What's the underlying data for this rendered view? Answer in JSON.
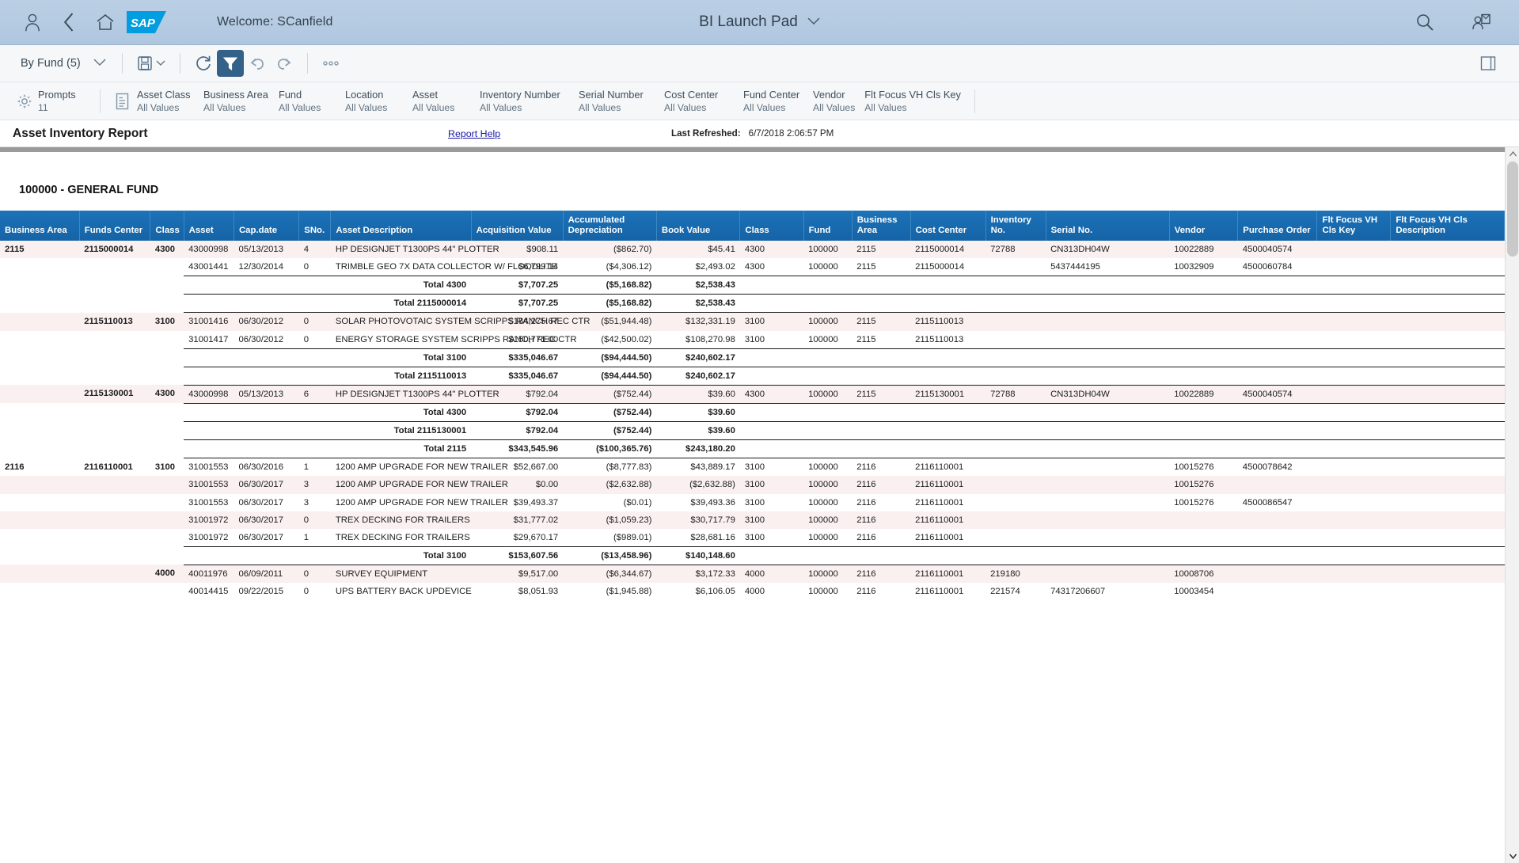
{
  "shell": {
    "welcome": "Welcome: SCanfield",
    "app_title": "BI Launch Pad",
    "icons": {
      "user": "user-icon",
      "back": "back-chevron-icon",
      "home": "home-icon",
      "logo": "sap-logo",
      "dropdown": "chevron-down-icon",
      "search": "search-icon",
      "contacts": "user-card-icon"
    },
    "colors": {
      "header_bg": "#b5cbe2",
      "sap_blue": "#009de0",
      "accent": "#346187"
    }
  },
  "toolbar": {
    "view_selector": "By Fund (5)",
    "buttons": [
      {
        "name": "save-button",
        "label": "save-icon"
      },
      {
        "name": "refresh-button",
        "label": "refresh-icon"
      },
      {
        "name": "filter-button",
        "label": "filter-icon",
        "active": true
      },
      {
        "name": "undo-button",
        "label": "undo-icon"
      },
      {
        "name": "redo-button",
        "label": "redo-icon"
      },
      {
        "name": "more-button",
        "label": "more-options-icon"
      },
      {
        "name": "sidepanel-button",
        "label": "side-panel-icon"
      }
    ]
  },
  "prompts": {
    "label": "Prompts",
    "count": "11",
    "all_values": "All Values",
    "items": [
      {
        "key": "Asset Class",
        "value": "All Values"
      },
      {
        "key": "Business Area",
        "value": "All Values"
      },
      {
        "key": "Fund",
        "value": "All Values"
      },
      {
        "key": "Location",
        "value": "All Values"
      },
      {
        "key": "Asset",
        "value": "All Values"
      },
      {
        "key": "Inventory Number",
        "value": "All Values"
      },
      {
        "key": "Serial Number",
        "value": "All Values"
      },
      {
        "key": "Cost Center",
        "value": "All Values"
      },
      {
        "key": "Fund Center",
        "value": "All Values"
      },
      {
        "key": "Vendor",
        "value": "All Values"
      },
      {
        "key": "Flt Focus VH Cls Key",
        "value": "All Values"
      }
    ]
  },
  "report": {
    "title": "Asset Inventory Report",
    "help_link": "Report Help",
    "last_refreshed_label": "Last Refreshed:",
    "last_refreshed_value": "6/7/2018 2:06:57 PM",
    "section_heading": "100000 - GENERAL FUND",
    "columns": [
      "Business Area",
      "Funds Center",
      "Class",
      "Asset",
      "Cap.date",
      "SNo.",
      "Asset Description",
      "Acquisition Value",
      "Accumulated Depreciation",
      "Book Value",
      "Class",
      "Fund",
      "Business Area",
      "Cost Center",
      "Inventory No.",
      "Serial No.",
      "Vendor",
      "Purchase Order",
      "Flt Focus VH Cls Key",
      "Flt Focus VH Cls Description"
    ],
    "rows": [
      {
        "type": "data",
        "shade": "pink",
        "business_area": "2115",
        "funds_center": "2115000014",
        "class": "4300",
        "asset": "43000998",
        "cap_date": "05/13/2013",
        "sno": "4",
        "description": "HP DESIGNJET T1300PS 44\" PLOTTER",
        "acquisition": "$908.11",
        "depreciation": "($862.70)",
        "book_value": "$45.41",
        "class2": "4300",
        "fund": "100000",
        "business_area2": "2115",
        "cost_center": "2115000014",
        "inventory_no": "72788",
        "serial_no": "CN313DH04W",
        "vendor": "10022889",
        "purchase_order": "4500040574",
        "flt_key": "",
        "flt_desc": ""
      },
      {
        "type": "data",
        "shade": "white",
        "business_area": "",
        "funds_center": "",
        "class": "",
        "asset": "43001441",
        "cap_date": "12/30/2014",
        "sno": "0",
        "description": "TRIMBLE GEO 7X DATA COLLECTOR W/ FLOODLITE",
        "acquisition": "$6,799.14",
        "depreciation": "($4,306.12)",
        "book_value": "$2,493.02",
        "class2": "4300",
        "fund": "100000",
        "business_area2": "2115",
        "cost_center": "2115000014",
        "inventory_no": "",
        "serial_no": "5437444195",
        "vendor": "10032909",
        "purchase_order": "4500060784",
        "flt_key": "",
        "flt_desc": ""
      },
      {
        "type": "total",
        "label": "Total 4300",
        "acquisition": "$7,707.25",
        "depreciation": "($5,168.82)",
        "book_value": "$2,538.43"
      },
      {
        "type": "total",
        "label": "Total 2115000014",
        "acquisition": "$7,707.25",
        "depreciation": "($5,168.82)",
        "book_value": "$2,538.43"
      },
      {
        "type": "data",
        "shade": "pink",
        "business_area": "",
        "funds_center": "2115110013",
        "class": "3100",
        "asset": "31001416",
        "cap_date": "06/30/2012",
        "sno": "0",
        "description": "SOLAR PHOTOVOTAIC SYSTEM SCRIPPS RANCH REC CTR",
        "acquisition": "$184,275.67",
        "depreciation": "($51,944.48)",
        "book_value": "$132,331.19",
        "class2": "3100",
        "fund": "100000",
        "business_area2": "2115",
        "cost_center": "2115110013",
        "inventory_no": "",
        "serial_no": "",
        "vendor": "",
        "purchase_order": "",
        "flt_key": "",
        "flt_desc": ""
      },
      {
        "type": "data",
        "shade": "white",
        "business_area": "",
        "funds_center": "",
        "class": "",
        "asset": "31001417",
        "cap_date": "06/30/2012",
        "sno": "0",
        "description": "ENERGY STORAGE SYSTEM SCRIPPS RANCH REC CTR",
        "acquisition": "$150,771.00",
        "depreciation": "($42,500.02)",
        "book_value": "$108,270.98",
        "class2": "3100",
        "fund": "100000",
        "business_area2": "2115",
        "cost_center": "2115110013",
        "inventory_no": "",
        "serial_no": "",
        "vendor": "",
        "purchase_order": "",
        "flt_key": "",
        "flt_desc": ""
      },
      {
        "type": "total",
        "label": "Total 3100",
        "acquisition": "$335,046.67",
        "depreciation": "($94,444.50)",
        "book_value": "$240,602.17"
      },
      {
        "type": "total",
        "label": "Total 2115110013",
        "acquisition": "$335,046.67",
        "depreciation": "($94,444.50)",
        "book_value": "$240,602.17"
      },
      {
        "type": "data",
        "shade": "pink",
        "business_area": "",
        "funds_center": "2115130001",
        "class": "4300",
        "asset": "43000998",
        "cap_date": "05/13/2013",
        "sno": "6",
        "description": "HP DESIGNJET T1300PS 44\" PLOTTER",
        "acquisition": "$792.04",
        "depreciation": "($752.44)",
        "book_value": "$39.60",
        "class2": "4300",
        "fund": "100000",
        "business_area2": "2115",
        "cost_center": "2115130001",
        "inventory_no": "72788",
        "serial_no": "CN313DH04W",
        "vendor": "10022889",
        "purchase_order": "4500040574",
        "flt_key": "",
        "flt_desc": ""
      },
      {
        "type": "total",
        "label": "Total 4300",
        "acquisition": "$792.04",
        "depreciation": "($752.44)",
        "book_value": "$39.60"
      },
      {
        "type": "total",
        "label": "Total 2115130001",
        "acquisition": "$792.04",
        "depreciation": "($752.44)",
        "book_value": "$39.60"
      },
      {
        "type": "total",
        "label": "Total 2115",
        "acquisition": "$343,545.96",
        "depreciation": "($100,365.76)",
        "book_value": "$243,180.20"
      },
      {
        "type": "data",
        "shade": "white",
        "business_area": "2116",
        "funds_center": "2116110001",
        "class": "3100",
        "asset": "31001553",
        "cap_date": "06/30/2016",
        "sno": "1",
        "description": "1200 AMP UPGRADE FOR NEW TRAILER",
        "acquisition": "$52,667.00",
        "depreciation": "($8,777.83)",
        "book_value": "$43,889.17",
        "class2": "3100",
        "fund": "100000",
        "business_area2": "2116",
        "cost_center": "2116110001",
        "inventory_no": "",
        "serial_no": "",
        "vendor": "10015276",
        "purchase_order": "4500078642",
        "flt_key": "",
        "flt_desc": ""
      },
      {
        "type": "data",
        "shade": "pink",
        "business_area": "",
        "funds_center": "",
        "class": "",
        "asset": "31001553",
        "cap_date": "06/30/2017",
        "sno": "3",
        "description": "1200 AMP UPGRADE FOR NEW TRAILER",
        "acquisition": "$0.00",
        "depreciation": "($2,632.88)",
        "book_value": "($2,632.88)",
        "class2": "3100",
        "fund": "100000",
        "business_area2": "2116",
        "cost_center": "2116110001",
        "inventory_no": "",
        "serial_no": "",
        "vendor": "10015276",
        "purchase_order": "",
        "flt_key": "",
        "flt_desc": ""
      },
      {
        "type": "data",
        "shade": "white",
        "business_area": "",
        "funds_center": "",
        "class": "",
        "asset": "31001553",
        "cap_date": "06/30/2017",
        "sno": "3",
        "description": "1200 AMP UPGRADE FOR NEW TRAILER",
        "acquisition": "$39,493.37",
        "depreciation": "($0.01)",
        "book_value": "$39,493.36",
        "class2": "3100",
        "fund": "100000",
        "business_area2": "2116",
        "cost_center": "2116110001",
        "inventory_no": "",
        "serial_no": "",
        "vendor": "10015276",
        "purchase_order": "4500086547",
        "flt_key": "",
        "flt_desc": ""
      },
      {
        "type": "data",
        "shade": "pink",
        "business_area": "",
        "funds_center": "",
        "class": "",
        "asset": "31001972",
        "cap_date": "06/30/2017",
        "sno": "0",
        "description": "TREX DECKING FOR TRAILERS",
        "acquisition": "$31,777.02",
        "depreciation": "($1,059.23)",
        "book_value": "$30,717.79",
        "class2": "3100",
        "fund": "100000",
        "business_area2": "2116",
        "cost_center": "2116110001",
        "inventory_no": "",
        "serial_no": "",
        "vendor": "",
        "purchase_order": "",
        "flt_key": "",
        "flt_desc": ""
      },
      {
        "type": "data",
        "shade": "white",
        "business_area": "",
        "funds_center": "",
        "class": "",
        "asset": "31001972",
        "cap_date": "06/30/2017",
        "sno": "1",
        "description": "TREX DECKING FOR TRAILERS",
        "acquisition": "$29,670.17",
        "depreciation": "($989.01)",
        "book_value": "$28,681.16",
        "class2": "3100",
        "fund": "100000",
        "business_area2": "2116",
        "cost_center": "2116110001",
        "inventory_no": "",
        "serial_no": "",
        "vendor": "",
        "purchase_order": "",
        "flt_key": "",
        "flt_desc": ""
      },
      {
        "type": "total",
        "label": "Total 3100",
        "acquisition": "$153,607.56",
        "depreciation": "($13,458.96)",
        "book_value": "$140,148.60"
      },
      {
        "type": "data",
        "shade": "pink",
        "business_area": "",
        "funds_center": "",
        "class": "4000",
        "asset": "40011976",
        "cap_date": "06/09/2011",
        "sno": "0",
        "description": "SURVEY EQUIPMENT",
        "acquisition": "$9,517.00",
        "depreciation": "($6,344.67)",
        "book_value": "$3,172.33",
        "class2": "4000",
        "fund": "100000",
        "business_area2": "2116",
        "cost_center": "2116110001",
        "inventory_no": "219180",
        "serial_no": "",
        "vendor": "10008706",
        "purchase_order": "",
        "flt_key": "",
        "flt_desc": ""
      },
      {
        "type": "data",
        "shade": "white",
        "business_area": "",
        "funds_center": "",
        "class": "",
        "asset": "40014415",
        "cap_date": "09/22/2015",
        "sno": "0",
        "description": "UPS BATTERY BACK UPDEVICE",
        "acquisition": "$8,051.93",
        "depreciation": "($1,945.88)",
        "book_value": "$6,106.05",
        "class2": "4000",
        "fund": "100000",
        "business_area2": "2116",
        "cost_center": "2116110001",
        "inventory_no": "221574",
        "serial_no": "74317206607",
        "vendor": "10003454",
        "purchase_order": "",
        "flt_key": "",
        "flt_desc": ""
      }
    ]
  }
}
